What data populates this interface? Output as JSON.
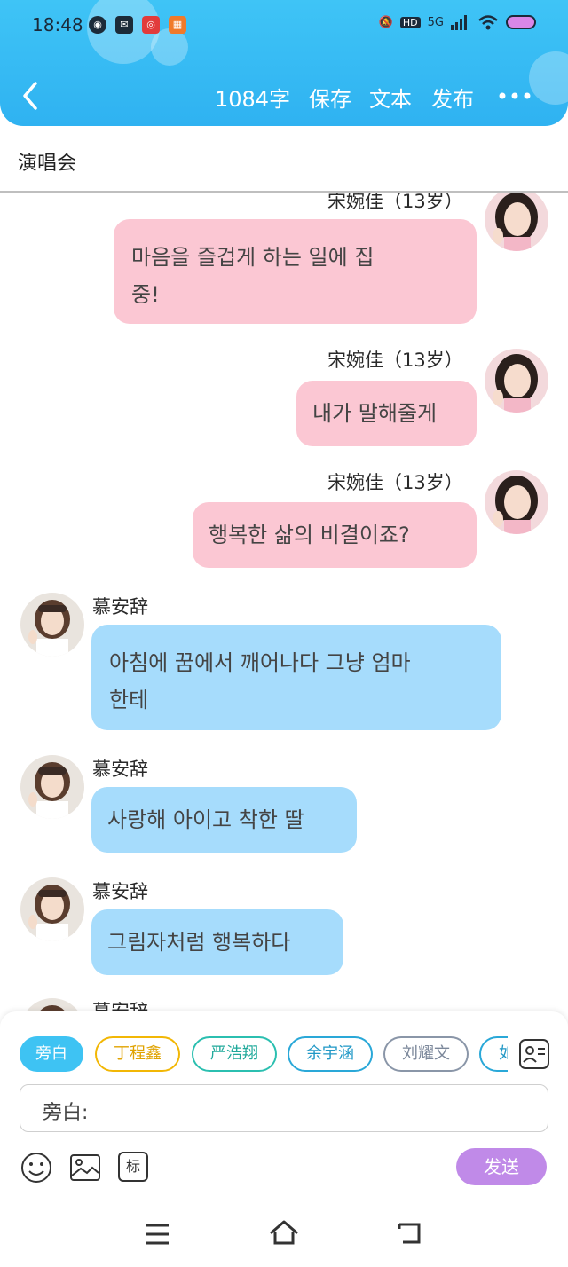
{
  "status_bar": {
    "time": "18:48",
    "network": "5G"
  },
  "nav": {
    "word_count": "1084字",
    "save": "保存",
    "text": "文本",
    "publish": "发布"
  },
  "doc_title": "演唱会",
  "messages": [
    {
      "speaker": "宋婉佳（13岁）",
      "lines": [
        "마음을 즐겁게 하는 일에 집",
        "중!"
      ],
      "side": "right"
    },
    {
      "speaker": "宋婉佳（13岁）",
      "lines": [
        "내가 말해줄게"
      ],
      "side": "right"
    },
    {
      "speaker": "宋婉佳（13岁）",
      "lines": [
        "행복한 삶의 비결이죠?"
      ],
      "side": "right"
    },
    {
      "speaker": "慕安辞",
      "lines": [
        "아침에 꿈에서 깨어나다 그냥 엄마",
        "한테"
      ],
      "side": "left"
    },
    {
      "speaker": "慕安辞",
      "lines": [
        "사랑해 아이고 착한 딸"
      ],
      "side": "left"
    },
    {
      "speaker": "慕安辞",
      "lines": [
        "그림자처럼 행복하다"
      ],
      "side": "left"
    },
    {
      "speaker": "慕安辞",
      "lines": [],
      "side": "left"
    }
  ],
  "role_chips": [
    {
      "label": "旁白",
      "color": "#3ec3f3",
      "selected": true
    },
    {
      "label": "丁程鑫",
      "color": "#f2b705",
      "selected": false
    },
    {
      "label": "严浩翔",
      "color": "#2bbfb0",
      "selected": false
    },
    {
      "label": "余宇涵",
      "color": "#2aa8d8",
      "selected": false
    },
    {
      "label": "刘耀文",
      "color": "#8a96a8",
      "selected": false
    },
    {
      "label": "如",
      "color": "#2aa8d8",
      "selected": false
    }
  ],
  "input": {
    "label": "旁白:"
  },
  "toolbar": {
    "tag_label": "标",
    "send_label": "发送"
  },
  "colors": {
    "header": "#35b9f4",
    "pink_bubble": "#fbc7d3",
    "blue_bubble": "#a6dcfc",
    "send": "#c08ae8"
  }
}
